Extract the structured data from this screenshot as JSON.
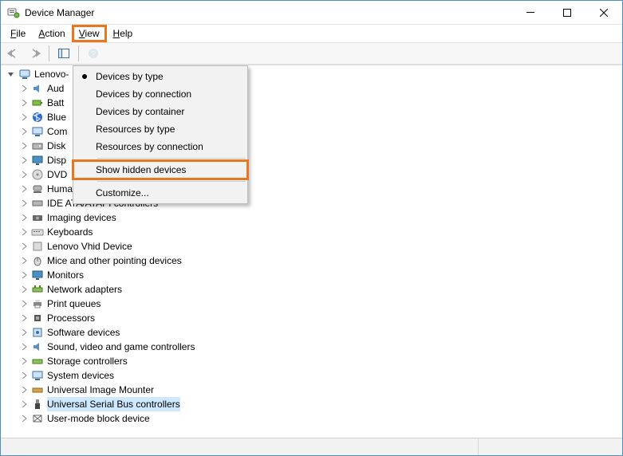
{
  "title": "Device Manager",
  "menubar": {
    "file": "File",
    "action": "Action",
    "view": "View",
    "help": "Help"
  },
  "view_menu": {
    "by_type": "Devices by type",
    "by_connection": "Devices by connection",
    "by_container": "Devices by container",
    "res_by_type": "Resources by type",
    "res_by_connection": "Resources by connection",
    "show_hidden": "Show hidden devices",
    "customize": "Customize..."
  },
  "tree": {
    "root": "Lenovo-",
    "items": [
      "Aud",
      "Batt",
      "Blue",
      "Com",
      "Disk",
      "Disp",
      "DVD",
      "Human Interface Devices",
      "IDE ATA/ATAPI controllers",
      "Imaging devices",
      "Keyboards",
      "Lenovo Vhid Device",
      "Mice and other pointing devices",
      "Monitors",
      "Network adapters",
      "Print queues",
      "Processors",
      "Software devices",
      "Sound, video and game controllers",
      "Storage controllers",
      "System devices",
      "Universal Image Mounter",
      "Universal Serial Bus controllers",
      "User-mode block device"
    ]
  }
}
